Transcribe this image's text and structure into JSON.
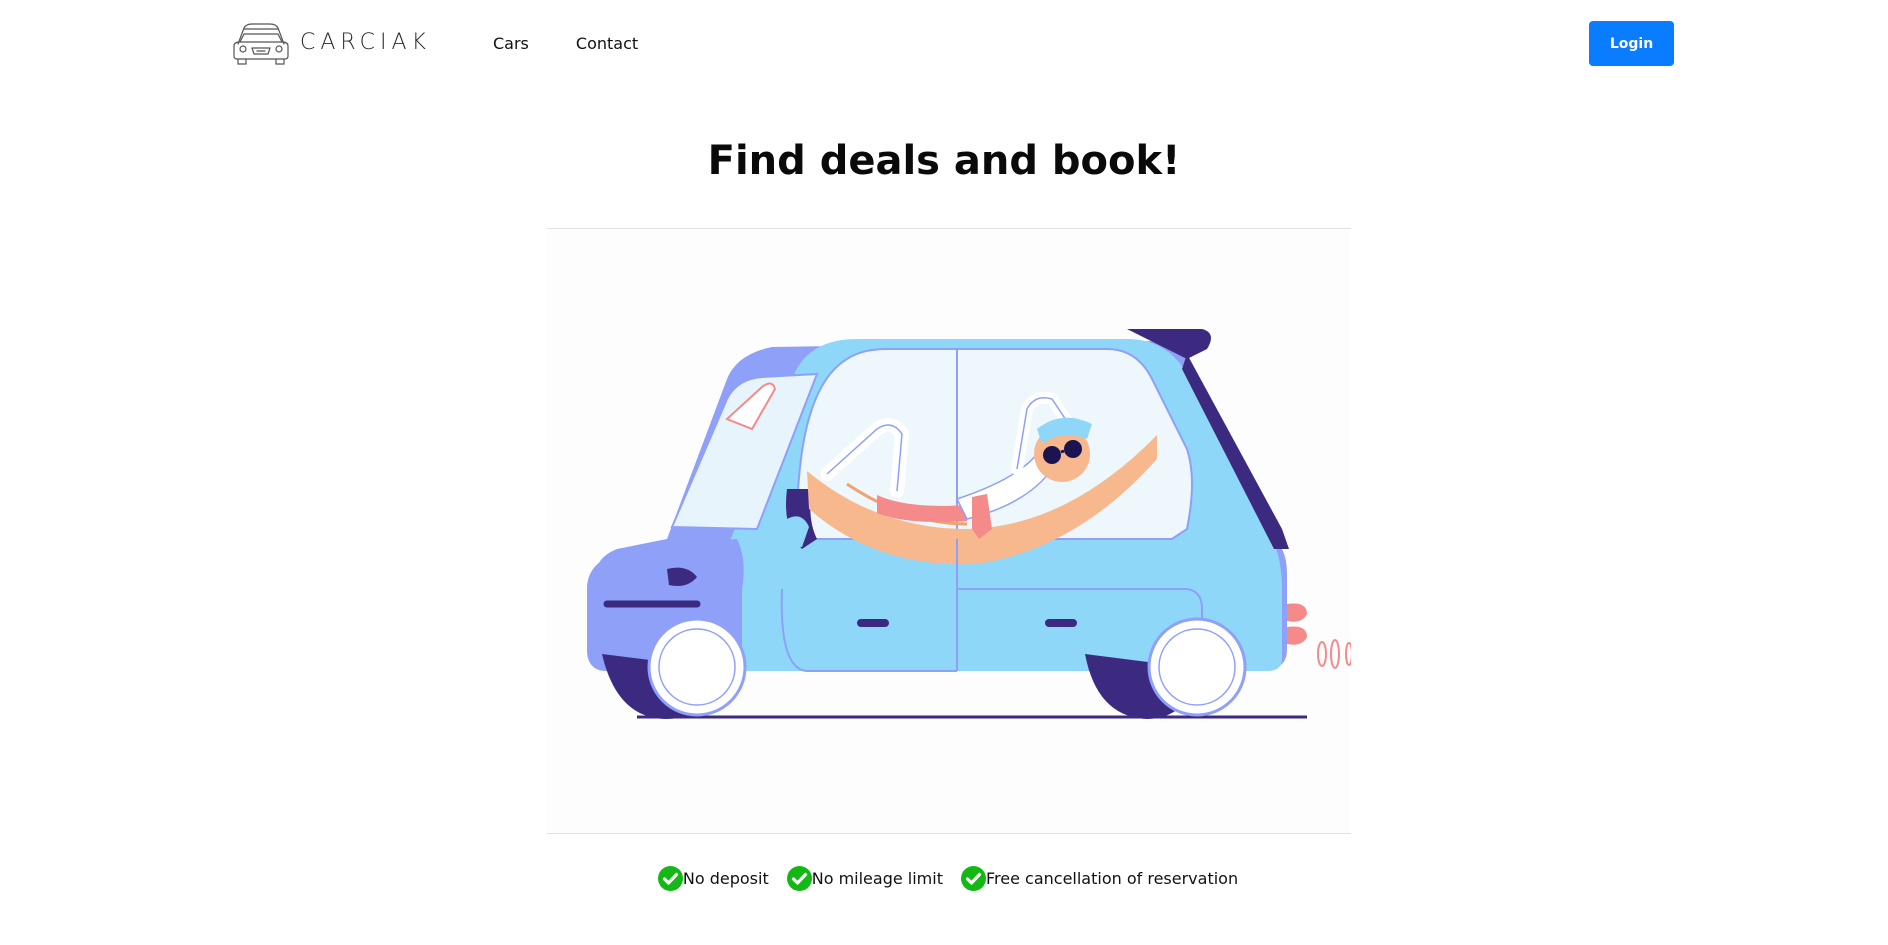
{
  "header": {
    "brand_name": "CARCIAK",
    "brand_logo_icon": "car-outline-icon",
    "nav": [
      {
        "label": "Cars"
      },
      {
        "label": "Contact"
      }
    ],
    "login_label": "Login",
    "login_color": "#0a7cff"
  },
  "main": {
    "title": "Find deals and book!",
    "hero_image": "car-hammock-illustration",
    "features": [
      {
        "icon": "green-check-icon",
        "label": "No deposit"
      },
      {
        "icon": "green-check-icon",
        "label": "No mileage limit"
      },
      {
        "icon": "green-check-icon",
        "label": "Free cancellation of reservation"
      }
    ],
    "check_color": "#14b814"
  }
}
